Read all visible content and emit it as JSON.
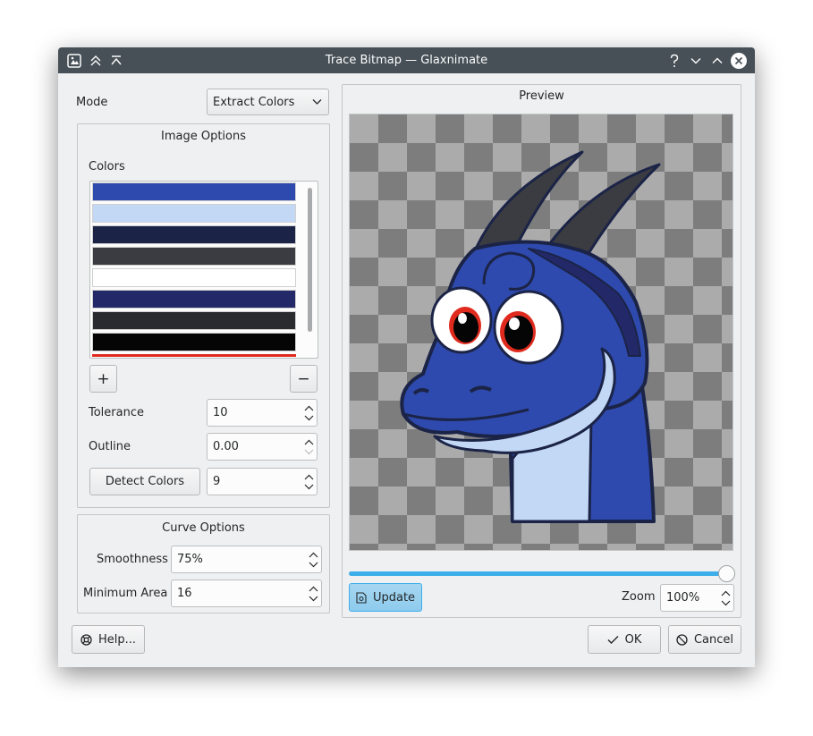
{
  "window": {
    "title": "Trace Bitmap — Glaxnimate"
  },
  "mode": {
    "label": "Mode",
    "value": "Extract Colors"
  },
  "image_options": {
    "title": "Image Options",
    "colors_label": "Colors",
    "colors": [
      "#2f4aae",
      "#c3d8f5",
      "#1b2447",
      "#3a3c41",
      "#ffffff",
      "#232968",
      "#2a2b2f",
      "#050505"
    ],
    "add_label": "+",
    "remove_label": "−",
    "tolerance": {
      "label": "Tolerance",
      "value": "10"
    },
    "outline": {
      "label": "Outline",
      "value": "0.00"
    },
    "detect": {
      "label": "Detect Colors",
      "value": "9"
    }
  },
  "curve_options": {
    "title": "Curve Options",
    "smoothness": {
      "label": "Smoothness",
      "value": "75%"
    },
    "min_area": {
      "label": "Minimum Area",
      "value": "16"
    }
  },
  "preview": {
    "title": "Preview",
    "slider_level": 1.0,
    "update_label": "Update",
    "zoom": {
      "label": "Zoom",
      "value": "100%"
    }
  },
  "footer": {
    "help_label": "Help...",
    "ok_label": "OK",
    "cancel_label": "Cancel"
  },
  "colors": {
    "accent": "#3daee9",
    "titlebar": "#475057",
    "window_bg": "#eff0f1"
  }
}
